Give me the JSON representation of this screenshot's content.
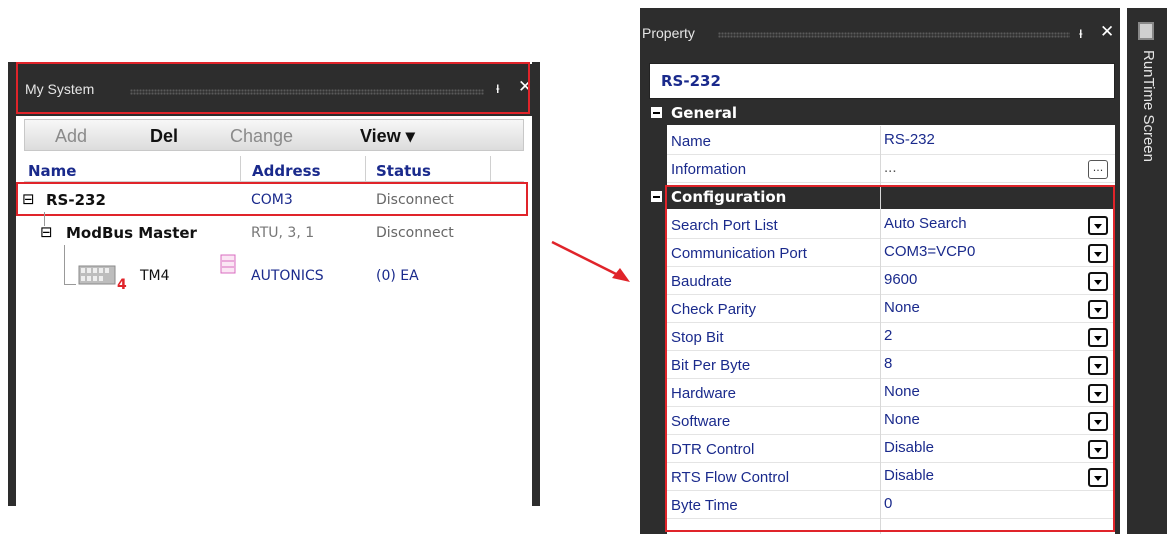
{
  "my_system": {
    "title": "My System",
    "toolbar": {
      "add": "Add",
      "del": "Del",
      "change": "Change",
      "view": "View ▾"
    },
    "columns": {
      "name": "Name",
      "address": "Address",
      "status": "Status"
    },
    "rows": [
      {
        "expander": "⊟",
        "name": "RS-232",
        "address": "COM3",
        "status": "Disconnect"
      },
      {
        "expander": "⊟",
        "name": "ModBus Master",
        "address": "RTU, 3, 1",
        "status": "Disconnect"
      },
      {
        "name": "TM4",
        "badge": "4",
        "address": "AUTONICS",
        "status": "(0) EA"
      }
    ]
  },
  "property": {
    "title": "Property",
    "object_name": "RS-232",
    "categories": {
      "general": "General",
      "configuration": "Configuration"
    },
    "general": [
      {
        "name": "Name",
        "value": "RS-232"
      },
      {
        "name": "Information",
        "value": "...",
        "button": "..."
      }
    ],
    "configuration": [
      {
        "name": "Search Port List",
        "value": "Auto Search"
      },
      {
        "name": "Communication Port",
        "value": "COM3=VCP0"
      },
      {
        "name": "Baudrate",
        "value": "9600"
      },
      {
        "name": "Check Parity",
        "value": "None"
      },
      {
        "name": "Stop Bit",
        "value": "2"
      },
      {
        "name": "Bit Per Byte",
        "value": "8"
      },
      {
        "name": "Hardware",
        "value": "None"
      },
      {
        "name": "Software",
        "value": "None"
      },
      {
        "name": "DTR Control",
        "value": "Disable"
      },
      {
        "name": "RTS Flow Control",
        "value": "Disable"
      },
      {
        "name": "Byte Time",
        "value": "0"
      }
    ]
  },
  "side_tab": {
    "label": "RunTime Screen"
  },
  "colors": {
    "panel_dark": "#2d2d2d",
    "highlight_red": "#e0242a",
    "text_blue": "#1a2a8c"
  },
  "icons": {
    "pin": "pin-icon",
    "close": "close-icon",
    "device": "device-module-icon",
    "status": "status-list-icon"
  }
}
